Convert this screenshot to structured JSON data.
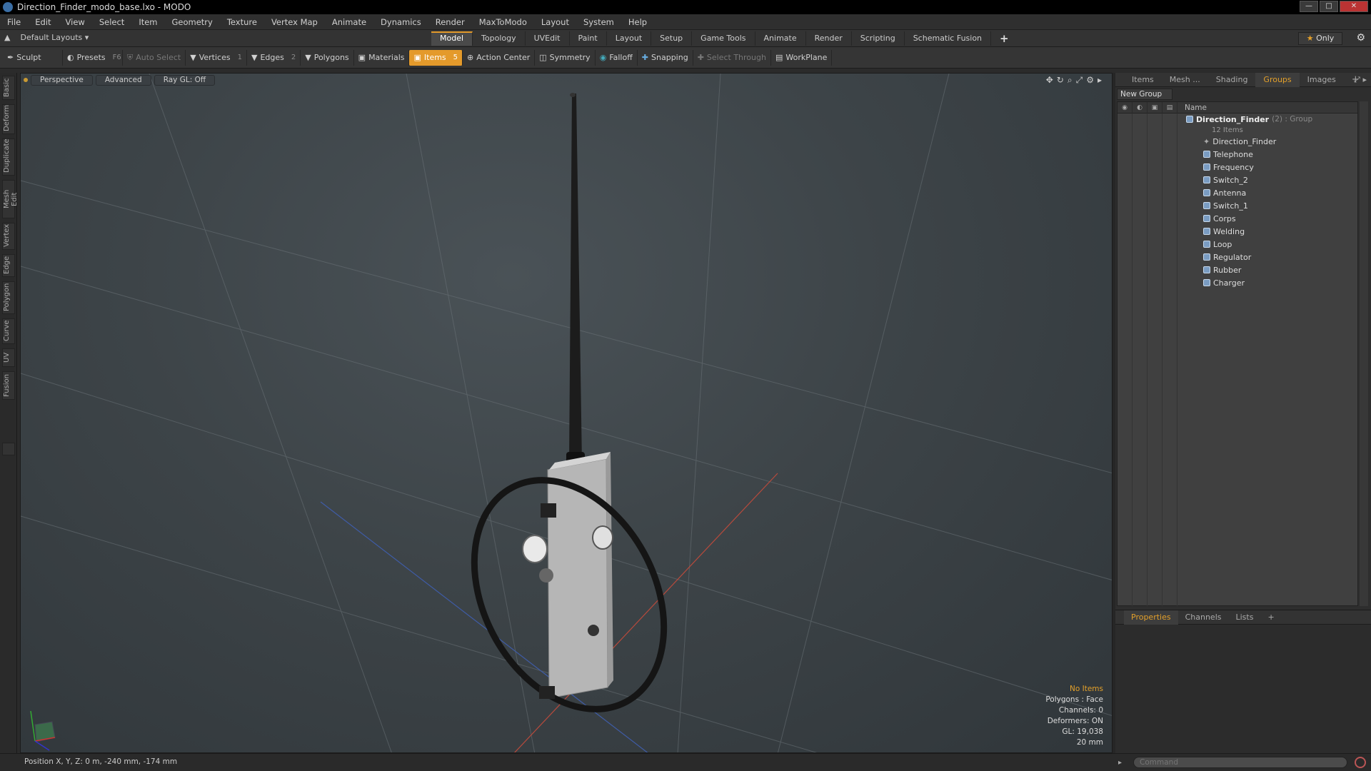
{
  "window": {
    "title": "Direction_Finder_modo_base.lxo - MODO"
  },
  "menu": [
    "File",
    "Edit",
    "View",
    "Select",
    "Item",
    "Geometry",
    "Texture",
    "Vertex Map",
    "Animate",
    "Dynamics",
    "Render",
    "MaxToModo",
    "Layout",
    "System",
    "Help"
  ],
  "layouts": {
    "selected": "Default Layouts",
    "tabs": [
      "Model",
      "Topology",
      "UVEdit",
      "Paint",
      "Layout",
      "Setup",
      "Game Tools",
      "Animate",
      "Render",
      "Scripting",
      "Schematic Fusion"
    ],
    "active_tab": "Model",
    "only_label": "Only"
  },
  "toolbar": {
    "sculpt": "Sculpt",
    "presets": "Presets",
    "presets_key": "F6",
    "auto_select": "Auto Select",
    "vertices": "Vertices",
    "vertices_key": "1",
    "edges": "Edges",
    "edges_key": "2",
    "polygons": "Polygons",
    "materials": "Materials",
    "items": "Items",
    "items_key": "5",
    "action_center": "Action Center",
    "symmetry": "Symmetry",
    "falloff": "Falloff",
    "snapping": "Snapping",
    "select_through": "Select Through",
    "workplane": "WorkPlane"
  },
  "left_tabs": [
    "Basic",
    "Deform",
    "Duplicate",
    "Mesh Edit",
    "Vertex",
    "Edge",
    "Polygon",
    "Curve",
    "UV",
    "Fusion"
  ],
  "viewport": {
    "view": "Perspective",
    "mode": "Advanced",
    "raygl": "Ray GL: Off",
    "info": {
      "selection": "No Items",
      "polygons": "Polygons : Face",
      "channels": "Channels: 0",
      "deformers": "Deformers: ON",
      "gl": "GL: 19,038",
      "scale": "20 mm"
    }
  },
  "status": {
    "position": "Position X, Y, Z:  0 m, -240 mm, -174 mm"
  },
  "right_panel": {
    "tabs": [
      "Items",
      "Mesh ...",
      "Shading",
      "Groups",
      "Images"
    ],
    "active_tab": "Groups",
    "new_group": "New Group",
    "name_header": "Name",
    "root": {
      "name": "Direction_Finder",
      "meta": "(2) : Group",
      "count": "12 Items"
    },
    "children": [
      "Direction_Finder",
      "Telephone",
      "Frequency",
      "Switch_2",
      "Antenna",
      "Switch_1",
      "Corps",
      "Welding",
      "Loop",
      "Regulator",
      "Rubber",
      "Charger"
    ]
  },
  "properties": {
    "tabs": [
      "Properties",
      "Channels",
      "Lists"
    ],
    "active_tab": "Properties"
  },
  "command": {
    "placeholder": "Command"
  }
}
